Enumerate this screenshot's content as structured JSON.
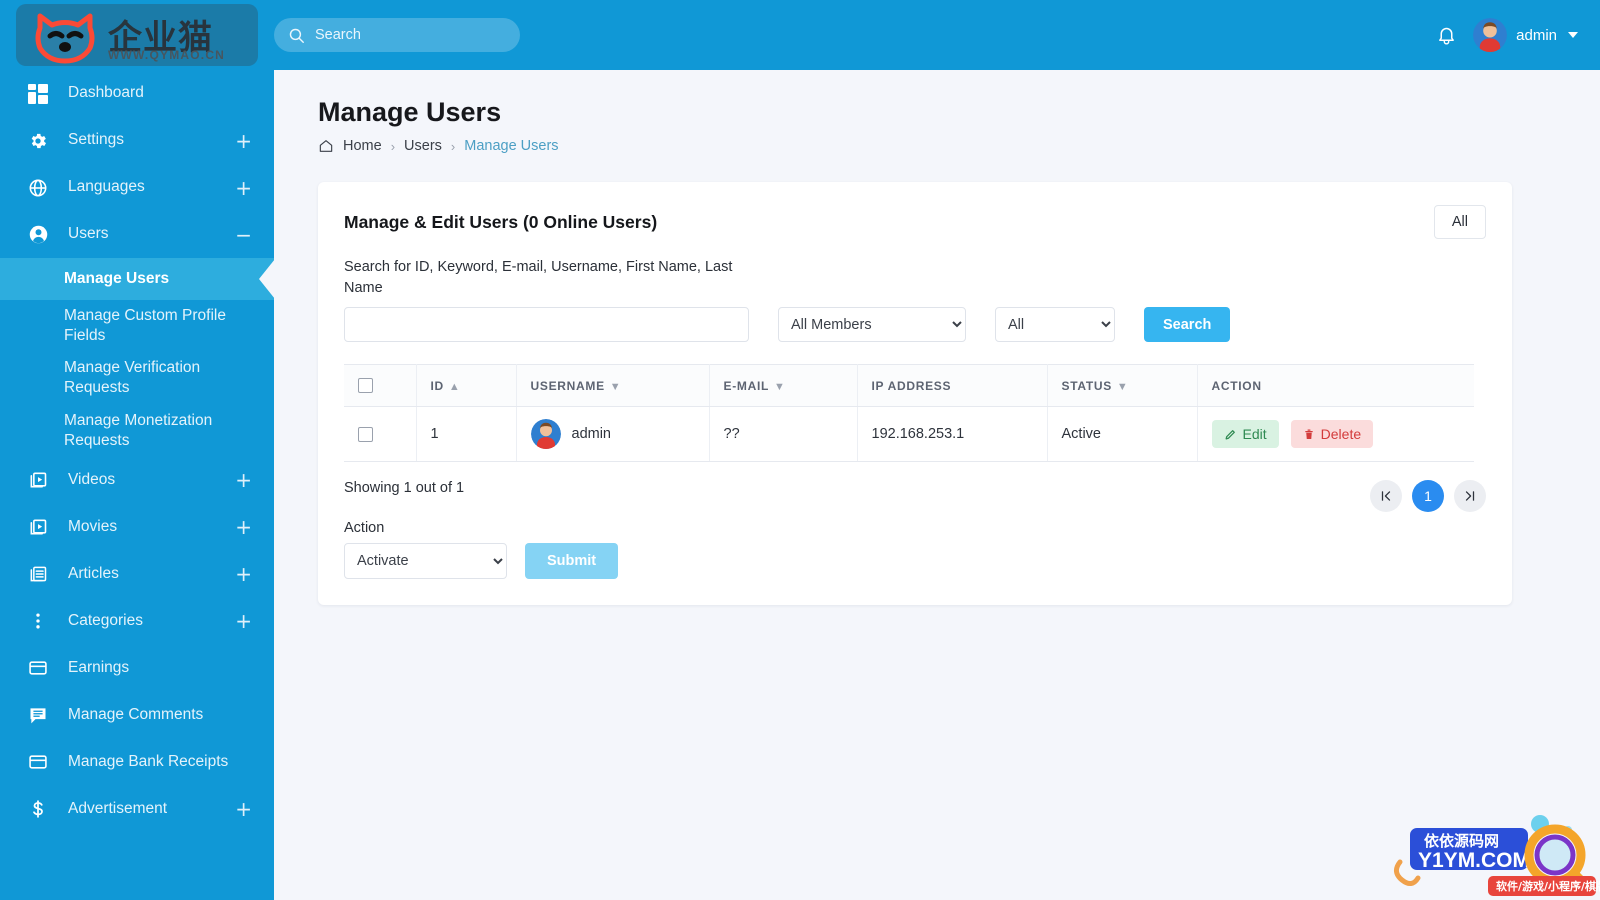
{
  "brand": {
    "logo_icon": "cat-face-icon",
    "name_cn": "企业猫",
    "url": "WWW.QYMAO.CN"
  },
  "topbar": {
    "search_placeholder": "Search",
    "search_value": "",
    "search_icon": "search-icon",
    "bell_icon": "bell-icon",
    "user_name": "admin",
    "caret_icon": "chevron-down-icon",
    "accent": "#1098d6"
  },
  "sidebar": {
    "bg": "#1098d6",
    "active_bg": "#2dadde",
    "items": [
      {
        "label": "Dashboard",
        "icon": "dashboard-grid-icon",
        "expander": ""
      },
      {
        "label": "Settings",
        "icon": "gear-icon",
        "expander": "+"
      },
      {
        "label": "Languages",
        "icon": "globe-icon",
        "expander": "+"
      },
      {
        "label": "Users",
        "icon": "user-circle-icon",
        "expander": "−"
      },
      {
        "label": "Videos",
        "icon": "video-icon",
        "expander": "+"
      },
      {
        "label": "Movies",
        "icon": "movie-icon",
        "expander": "+"
      },
      {
        "label": "Articles",
        "icon": "article-icon",
        "expander": "+"
      },
      {
        "label": "Categories",
        "icon": "dots-vertical-icon",
        "expander": "+"
      },
      {
        "label": "Earnings",
        "icon": "card-icon",
        "expander": ""
      },
      {
        "label": "Manage Comments",
        "icon": "comment-icon",
        "expander": ""
      },
      {
        "label": "Manage Bank Receipts",
        "icon": "card-icon",
        "expander": ""
      },
      {
        "label": "Advertisement",
        "icon": "dollar-icon",
        "expander": "+"
      }
    ],
    "users_sub": [
      {
        "label": "Manage Users",
        "active": true
      },
      {
        "label": "Manage Custom Profile Fields",
        "active": false
      },
      {
        "label": "Manage Verification Requests",
        "active": false
      },
      {
        "label": "Manage Monetization Requests",
        "active": false
      }
    ]
  },
  "page": {
    "title": "Manage Users",
    "breadcrumb": {
      "home_icon": "home-icon",
      "items": [
        "Home",
        "Users",
        "Manage Users"
      ],
      "separator": "›",
      "current_color": "#4c9fc4"
    }
  },
  "card": {
    "title": "Manage & Edit Users (0 Online Users)",
    "all_button": "All",
    "search_field_label": "Search for ID, Keyword, E-mail, Username, First Name, Last Name",
    "search_field_value": "",
    "member_select": {
      "value": "All Members",
      "options": [
        "All Members"
      ]
    },
    "type_select": {
      "value": "All",
      "options": [
        "All"
      ]
    },
    "search_button": "Search"
  },
  "table": {
    "headers": [
      {
        "label": "",
        "sort": "",
        "name": "select-all"
      },
      {
        "label": "ID",
        "sort": "▲",
        "name": "id"
      },
      {
        "label": "USERNAME",
        "sort": "▼",
        "name": "username"
      },
      {
        "label": "E-MAIL",
        "sort": "▼",
        "name": "email"
      },
      {
        "label": "IP ADDRESS",
        "sort": "",
        "name": "ip-address"
      },
      {
        "label": "STATUS",
        "sort": "▼",
        "name": "status"
      },
      {
        "label": "ACTION",
        "sort": "",
        "name": "action"
      }
    ],
    "rows": [
      {
        "id": "1",
        "username": "admin",
        "avatar_icon": "user-avatar",
        "email": "??",
        "ip": "192.168.253.1",
        "status": "Active",
        "edit_label": "Edit",
        "edit_icon": "pencil-icon",
        "delete_label": "Delete",
        "delete_icon": "trash-icon"
      }
    ]
  },
  "footer": {
    "showing": "Showing 1 out of 1",
    "pagination": {
      "first_icon": "chevron-first-icon",
      "last_icon": "chevron-last-icon",
      "pages": [
        "1"
      ],
      "active_page": "1"
    },
    "action_label": "Action",
    "action_select": {
      "value": "Activate",
      "options": [
        "Activate"
      ]
    },
    "submit_button": "Submit"
  },
  "watermark": {
    "site_cn": "依依源码网",
    "site_url": "Y1YM.COM",
    "tagline": "软件/游戏/小程序/棋牌"
  }
}
